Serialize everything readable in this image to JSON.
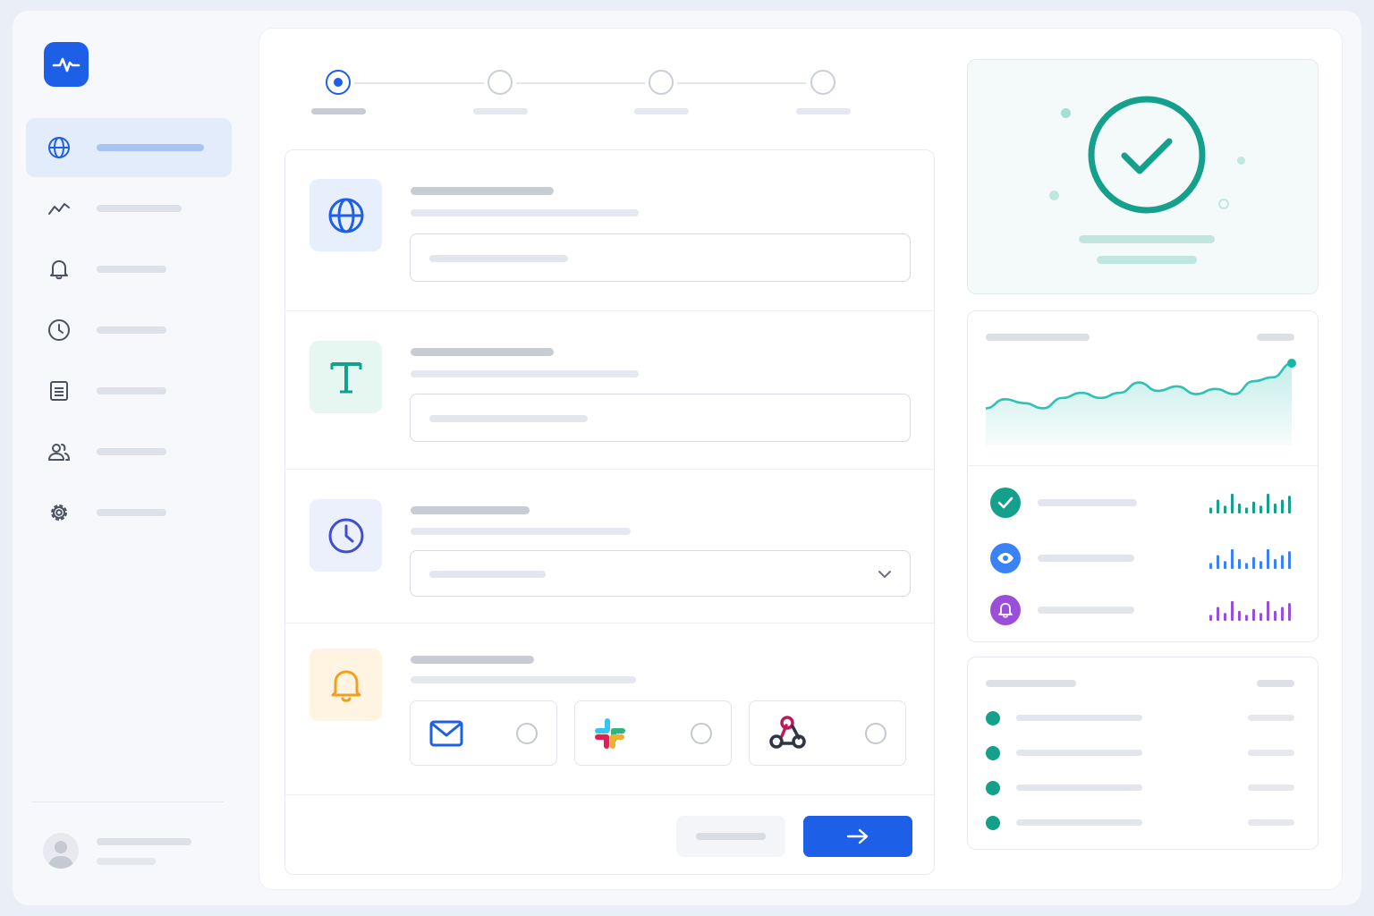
{
  "sidebar": {
    "logo": {
      "icon": "pulse-icon",
      "color": "#1d5fe6"
    },
    "items": [
      {
        "key": "overview",
        "icon": "globe-icon",
        "active": true
      },
      {
        "key": "analytics",
        "icon": "trend-icon",
        "active": false
      },
      {
        "key": "alerts",
        "icon": "bell-icon",
        "active": false
      },
      {
        "key": "history",
        "icon": "clock-icon",
        "active": false
      },
      {
        "key": "reports",
        "icon": "document-icon",
        "active": false
      },
      {
        "key": "team",
        "icon": "users-icon",
        "active": false
      },
      {
        "key": "settings",
        "icon": "gear-icon",
        "active": false
      }
    ],
    "user": {
      "icon": "avatar-icon"
    }
  },
  "wizard": {
    "steps_total": 4,
    "active_step": 1
  },
  "form": {
    "sections": [
      {
        "key": "url",
        "icon": "globe-icon",
        "control": "text-input"
      },
      {
        "key": "name",
        "icon": "text-icon",
        "control": "text-input"
      },
      {
        "key": "interval",
        "icon": "clock-icon",
        "control": "select"
      },
      {
        "key": "notifications",
        "icon": "bell-icon",
        "control": "channel-options"
      }
    ],
    "channels": [
      {
        "key": "email",
        "icon": "mail-icon",
        "selected": false
      },
      {
        "key": "slack",
        "icon": "slack-icon",
        "selected": false
      },
      {
        "key": "webhook",
        "icon": "webhook-icon",
        "selected": false
      }
    ],
    "next_icon": "arrow-right-icon"
  },
  "status": {
    "icon": "check-circle-icon",
    "color": "#14a08a"
  },
  "stats": {
    "trend_chart": {
      "color": "#2fc1b3",
      "values": [
        0.3,
        0.44,
        0.38,
        0.3,
        0.46,
        0.54,
        0.46,
        0.54,
        0.7,
        0.57,
        0.64,
        0.52,
        0.6,
        0.52,
        0.72,
        0.78,
        1.0
      ]
    },
    "rows": [
      {
        "key": "up",
        "icon": "check-icon",
        "color": "#14a08a"
      },
      {
        "key": "views",
        "icon": "eye-icon",
        "color": "#3b82f6"
      },
      {
        "key": "alerts",
        "icon": "bell-icon",
        "color": "#9a4fd8"
      }
    ],
    "spark_values": [
      0.3,
      0.7,
      0.4,
      1.0,
      0.5,
      0.3,
      0.6,
      0.4,
      1.0,
      0.5,
      0.7,
      0.9
    ]
  },
  "list": {
    "item_count": 4,
    "dot_color": "#14a08a"
  }
}
